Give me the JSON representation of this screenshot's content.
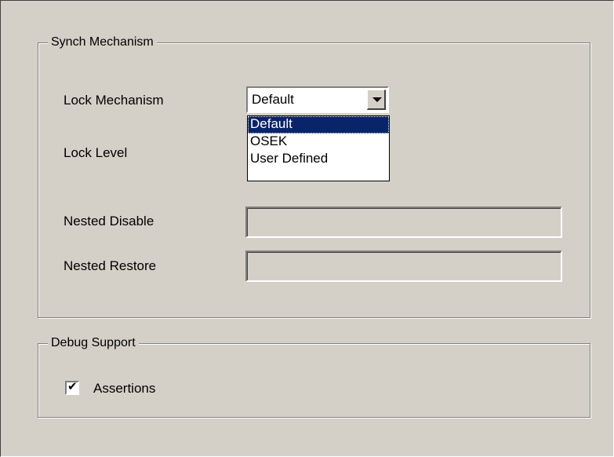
{
  "synch_group": {
    "title": "Synch Mechanism",
    "lock_mechanism_label": "Lock Mechanism",
    "lock_mechanism_value": "Default",
    "lock_mechanism_options": [
      "Default",
      "OSEK",
      "User Defined"
    ],
    "lock_level_label": "Lock Level",
    "nested_disable_label": "Nested Disable",
    "nested_disable_value": "",
    "nested_restore_label": "Nested Restore",
    "nested_restore_value": ""
  },
  "debug_group": {
    "title": "Debug Support",
    "assertions_label": "Assertions",
    "assertions_checked": true
  },
  "icons": {
    "dropdown": "chevron-down-icon",
    "check": "checkmark-icon"
  },
  "colors": {
    "background": "#d4d0c8",
    "selection": "#0a246a"
  }
}
